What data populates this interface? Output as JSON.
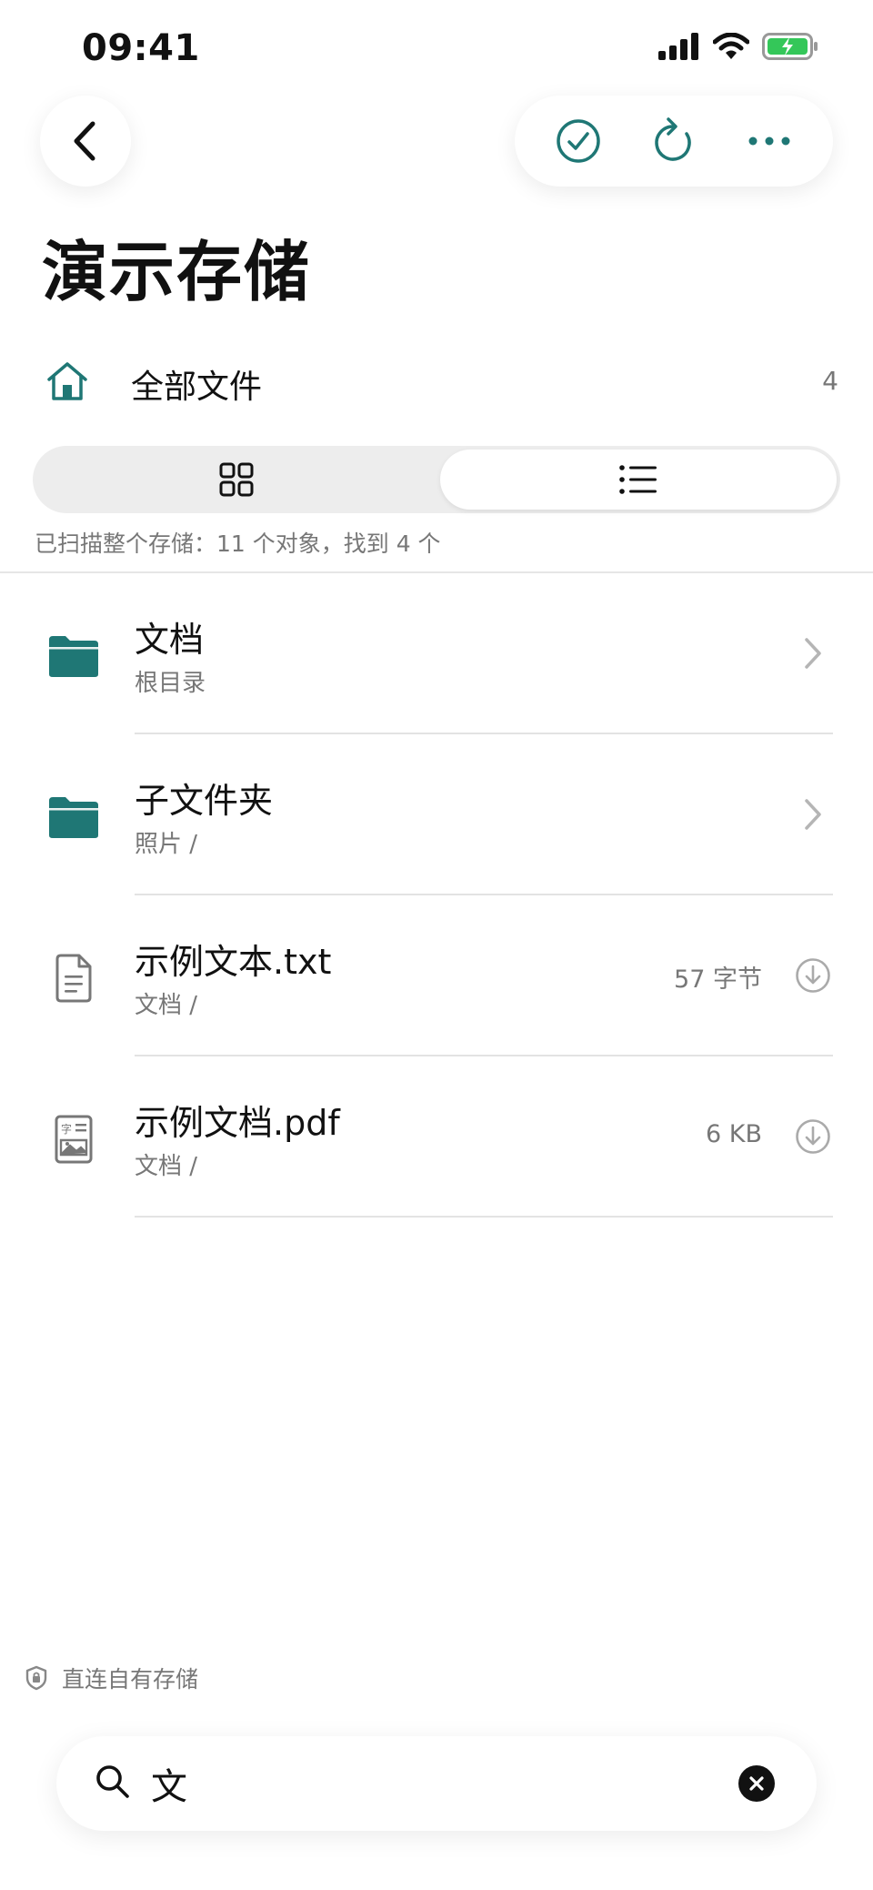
{
  "status_bar": {
    "time": "09:41"
  },
  "header": {
    "title": "演示存储"
  },
  "breadcrumb": {
    "label": "全部文件",
    "count": "4"
  },
  "view_toggle": {
    "options": [
      "grid",
      "list"
    ],
    "selected": "list"
  },
  "scan_info": "已扫描整个存储：11 个对象，找到 4 个",
  "files": [
    {
      "name": "文档",
      "path": "根目录",
      "type": "folder",
      "size": ""
    },
    {
      "name": "子文件夹",
      "path": "照片 /",
      "type": "folder",
      "size": ""
    },
    {
      "name": "示例文本.txt",
      "path": "文档 /",
      "type": "text-file",
      "size": "57 字节"
    },
    {
      "name": "示例文档.pdf",
      "path": "文档 /",
      "type": "pdf-file",
      "size": "6 KB"
    }
  ],
  "footer": {
    "note": "直连自有存储"
  },
  "search": {
    "value": "文"
  },
  "colors": {
    "accent": "#1f7775",
    "text": "#111111",
    "secondary": "#777777"
  }
}
